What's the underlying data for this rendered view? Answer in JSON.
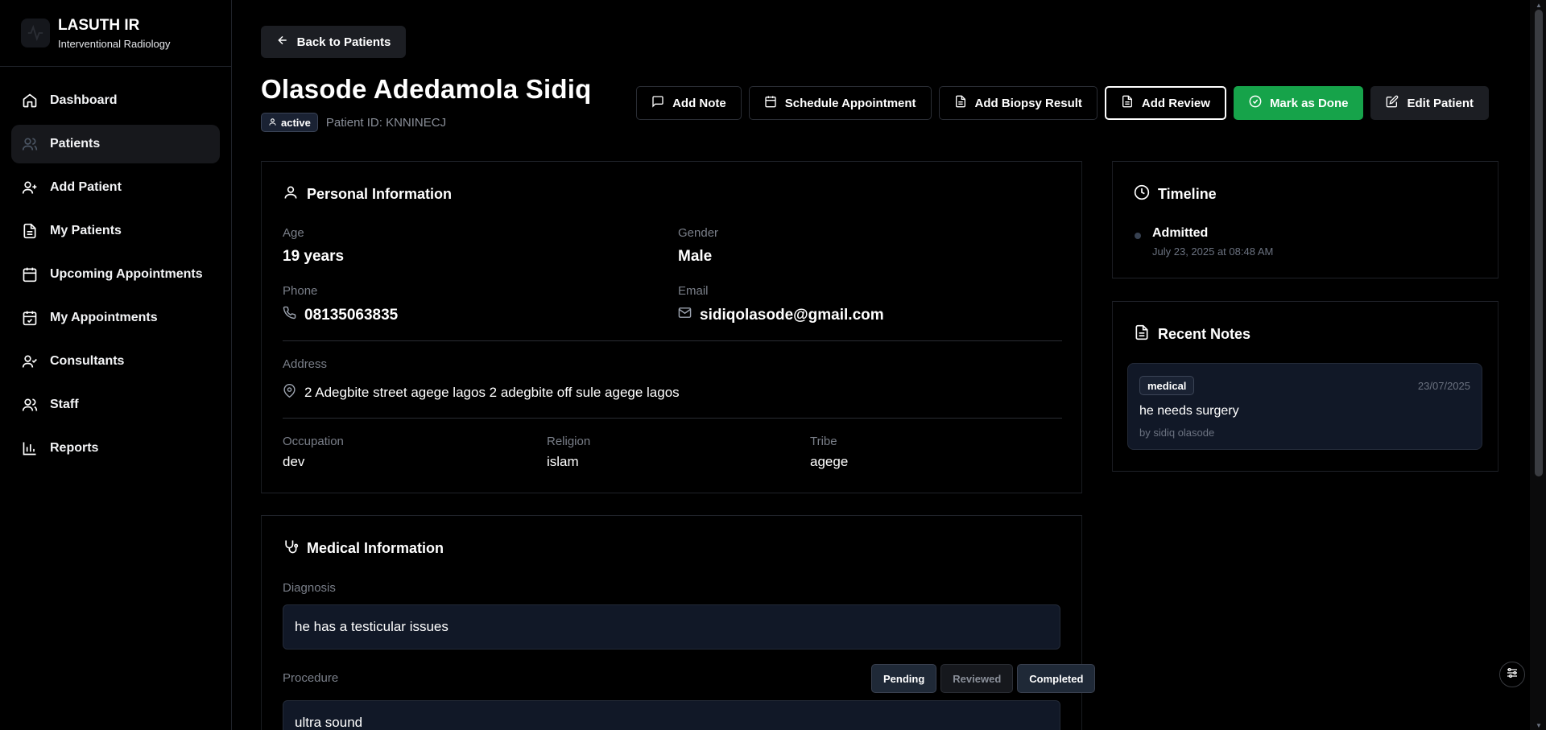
{
  "brand": {
    "title": "LASUTH IR",
    "subtitle": "Interventional Radiology"
  },
  "sidebar": {
    "items": [
      {
        "label": "Dashboard",
        "icon": "home-icon"
      },
      {
        "label": "Patients",
        "icon": "users-icon",
        "active": true
      },
      {
        "label": "Add Patient",
        "icon": "user-plus-icon"
      },
      {
        "label": "My Patients",
        "icon": "file-text-icon"
      },
      {
        "label": "Upcoming Appointments",
        "icon": "calendar-icon"
      },
      {
        "label": "My Appointments",
        "icon": "calendar-check-icon"
      },
      {
        "label": "Consultants",
        "icon": "user-check-icon"
      },
      {
        "label": "Staff",
        "icon": "users-icon"
      },
      {
        "label": "Reports",
        "icon": "bar-chart-icon"
      }
    ]
  },
  "header": {
    "back_label": "Back to Patients",
    "patient_name": "Olasode Adedamola Sidiq",
    "status": "active",
    "patient_id": "Patient ID: KNNINECJ"
  },
  "actions": {
    "add_note": "Add Note",
    "schedule": "Schedule Appointment",
    "biopsy": "Add Biopsy Result",
    "review": "Add Review",
    "done": "Mark as Done",
    "edit": "Edit Patient"
  },
  "personal": {
    "title": "Personal Information",
    "age_label": "Age",
    "age": "19 years",
    "gender_label": "Gender",
    "gender": "Male",
    "phone_label": "Phone",
    "phone": "08135063835",
    "email_label": "Email",
    "email": "sidiqolasode@gmail.com",
    "address_label": "Address",
    "address": "2 Adegbite street agege lagos 2 adegbite off sule agege lagos",
    "occupation_label": "Occupation",
    "occupation": "dev",
    "religion_label": "Religion",
    "religion": "islam",
    "tribe_label": "Tribe",
    "tribe": "agege"
  },
  "medical": {
    "title": "Medical Information",
    "diagnosis_label": "Diagnosis",
    "diagnosis": "he has a testicular issues",
    "procedure_label": "Procedure",
    "procedure": "ultra sound",
    "procedure_status": [
      "Pending",
      "Reviewed",
      "Completed"
    ]
  },
  "timeline": {
    "title": "Timeline",
    "events": [
      {
        "label": "Admitted",
        "time": "July 23, 2025 at 08:48 AM"
      }
    ]
  },
  "notes": {
    "title": "Recent Notes",
    "items": [
      {
        "tag": "medical",
        "date": "23/07/2025",
        "text": "he needs surgery",
        "author": "by sidiq olasode"
      }
    ]
  },
  "colors": {
    "accent_green": "#16a34a",
    "field_bg": "#111827",
    "background": "#000000"
  }
}
